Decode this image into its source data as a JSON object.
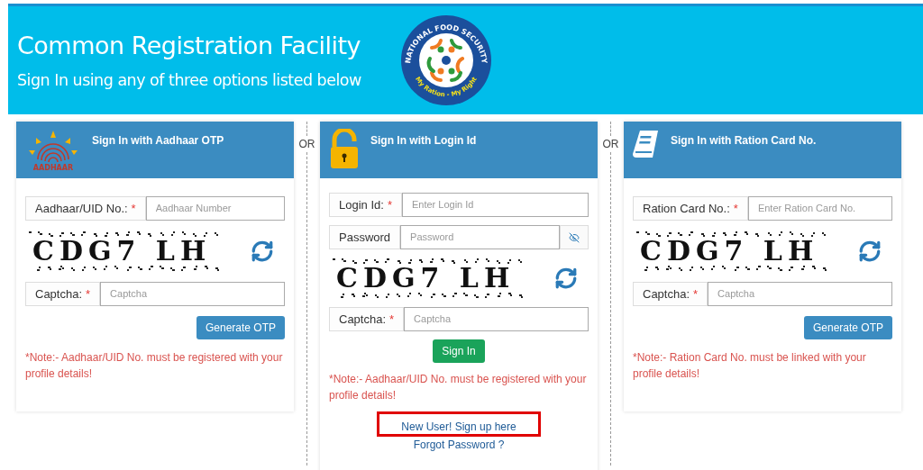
{
  "header": {
    "title": "Common Registration Facility",
    "subtitle": "Sign In using any of three options listed below",
    "logo": {
      "top_text": "NATIONAL FOOD SECURITY",
      "bottom_text": "My Ration - My Right"
    }
  },
  "separators": [
    "OR",
    "OR"
  ],
  "panels": [
    {
      "kind": "aadhaar",
      "logo_text": "AADHAAR",
      "title": "Sign In with Aadhaar OTP",
      "rows": [
        {
          "kind": "field",
          "label": "Aadhaar/UID No.:",
          "required_mark": "*",
          "placeholder": "Aadhaar Number"
        },
        {
          "kind": "captcha",
          "text": "CDG7 LH"
        },
        {
          "kind": "field",
          "label": "Captcha:",
          "required_mark": "*",
          "placeholder": "Captcha"
        },
        {
          "kind": "button",
          "label": "Generate OTP"
        },
        {
          "kind": "note",
          "text": "*Note:- Aadhaar/UID No. must be registered with your profile details!"
        }
      ]
    },
    {
      "kind": "login",
      "title": "Sign In with Login Id",
      "rows": [
        {
          "kind": "field",
          "label": "Login Id:",
          "required_mark": "*",
          "placeholder": "Enter Login Id"
        },
        {
          "kind": "password",
          "label": "Password",
          "placeholder": "Password"
        },
        {
          "kind": "captcha",
          "text": "CDG7 LH"
        },
        {
          "kind": "field",
          "label": "Captcha:",
          "required_mark": "*",
          "placeholder": "Captcha"
        },
        {
          "kind": "button",
          "label": "Sign In"
        },
        {
          "kind": "note",
          "text": "*Note:- Aadhaar/UID No. must be registered with your profile details!"
        },
        {
          "kind": "link",
          "text": "New User! Sign up here",
          "highlighted": true
        },
        {
          "kind": "link",
          "text": "Forgot Password ?",
          "highlighted": false
        }
      ]
    },
    {
      "kind": "ration",
      "title": "Sign In with Ration Card No.",
      "rows": [
        {
          "kind": "field",
          "label": "Ration Card No.:",
          "required_mark": "*",
          "placeholder": "Enter Ration Card No."
        },
        {
          "kind": "captcha",
          "text": "CDG7 LH"
        },
        {
          "kind": "field",
          "label": "Captcha:",
          "required_mark": "*",
          "placeholder": "Captcha"
        },
        {
          "kind": "button",
          "label": "Generate OTP"
        },
        {
          "kind": "note",
          "text": "*Note:- Ration Card No. must be linked with your profile details!"
        }
      ]
    }
  ]
}
